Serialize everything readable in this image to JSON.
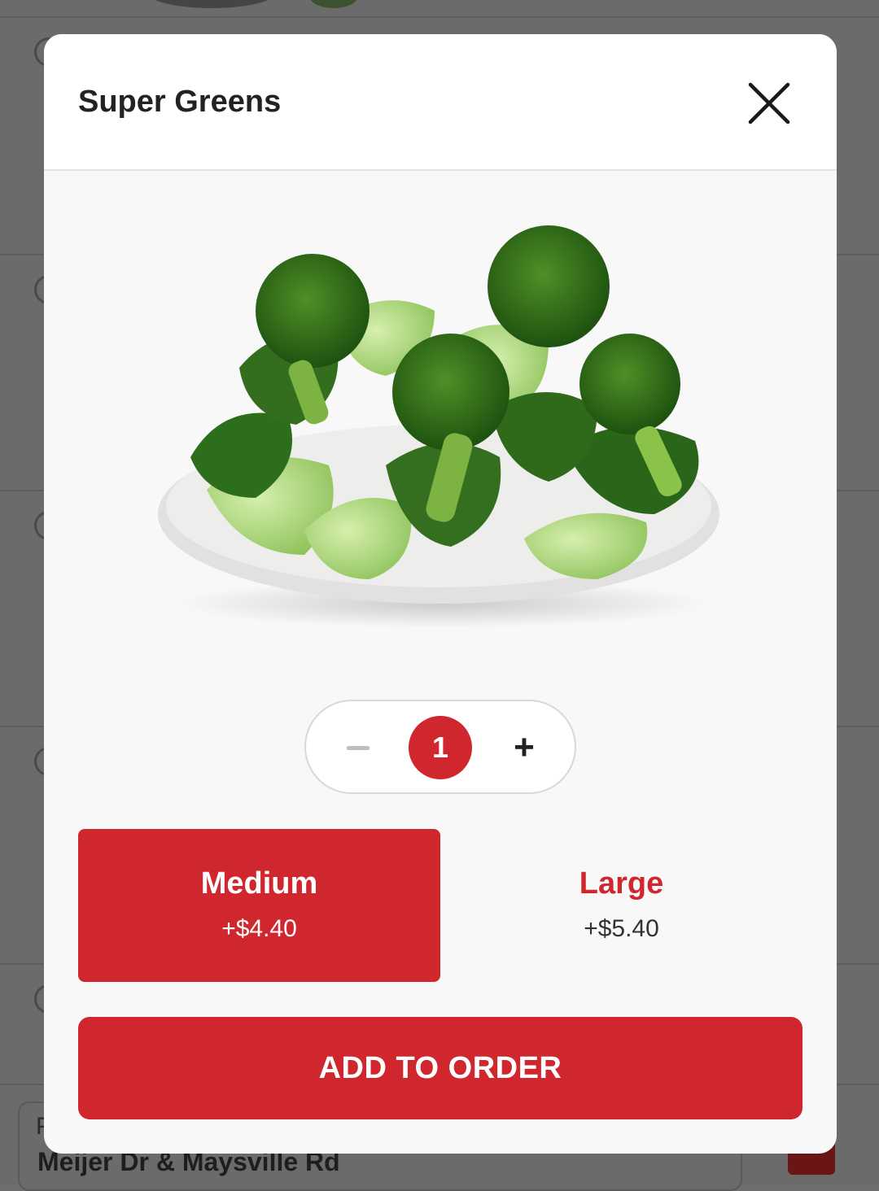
{
  "background": {
    "location_label_partial": "P",
    "location_name": "Meijer Dr & Maysville Rd"
  },
  "modal": {
    "title": "Super Greens",
    "image_alt": "Super Greens dish",
    "quantity": {
      "minus_icon": "minus-icon",
      "value": "1",
      "plus_icon": "plus-icon",
      "plus_label": "+"
    },
    "sizes": [
      {
        "name": "Medium",
        "price": "+$4.40",
        "selected": true
      },
      {
        "name": "Large",
        "price": "+$5.40",
        "selected": false
      }
    ],
    "add_button_label": "ADD TO ORDER"
  },
  "colors": {
    "accent": "#d0262d",
    "overlay": "#6b6b6b",
    "modal_bg": "#f8f8f8"
  }
}
